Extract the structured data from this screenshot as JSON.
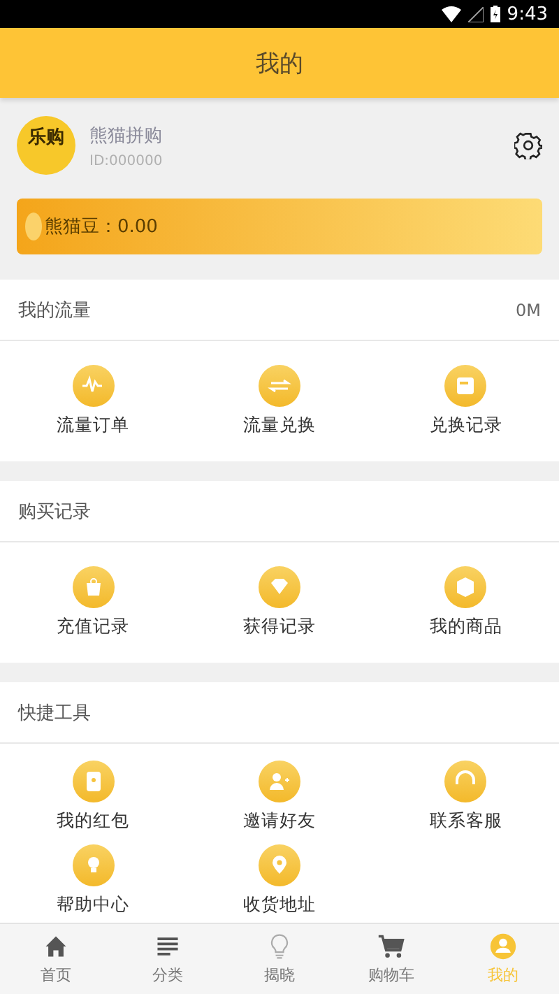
{
  "status_bar": {
    "time": "9:43"
  },
  "header": {
    "title": "我的"
  },
  "profile": {
    "avatar_text": "乐购",
    "name": "熊猫拼购",
    "id": "ID:000000",
    "beans": "熊猫豆：0.00"
  },
  "sections": [
    {
      "title": "我的流量",
      "value": "0M",
      "items": [
        "流量订单",
        "流量兑换",
        "兑换记录"
      ]
    },
    {
      "title": "购买记录",
      "items": [
        "充值记录",
        "获得记录",
        "我的商品"
      ]
    },
    {
      "title": "快捷工具",
      "items": [
        "我的红包",
        "邀请好友",
        "联系客服",
        "帮助中心",
        "收货地址"
      ]
    }
  ],
  "tab_bar": [
    {
      "label": "首页",
      "selected": false
    },
    {
      "label": "分类",
      "selected": false
    },
    {
      "label": "揭晓",
      "selected": false
    },
    {
      "label": "购物车",
      "selected": false
    },
    {
      "label": "我的",
      "selected": true
    }
  ]
}
